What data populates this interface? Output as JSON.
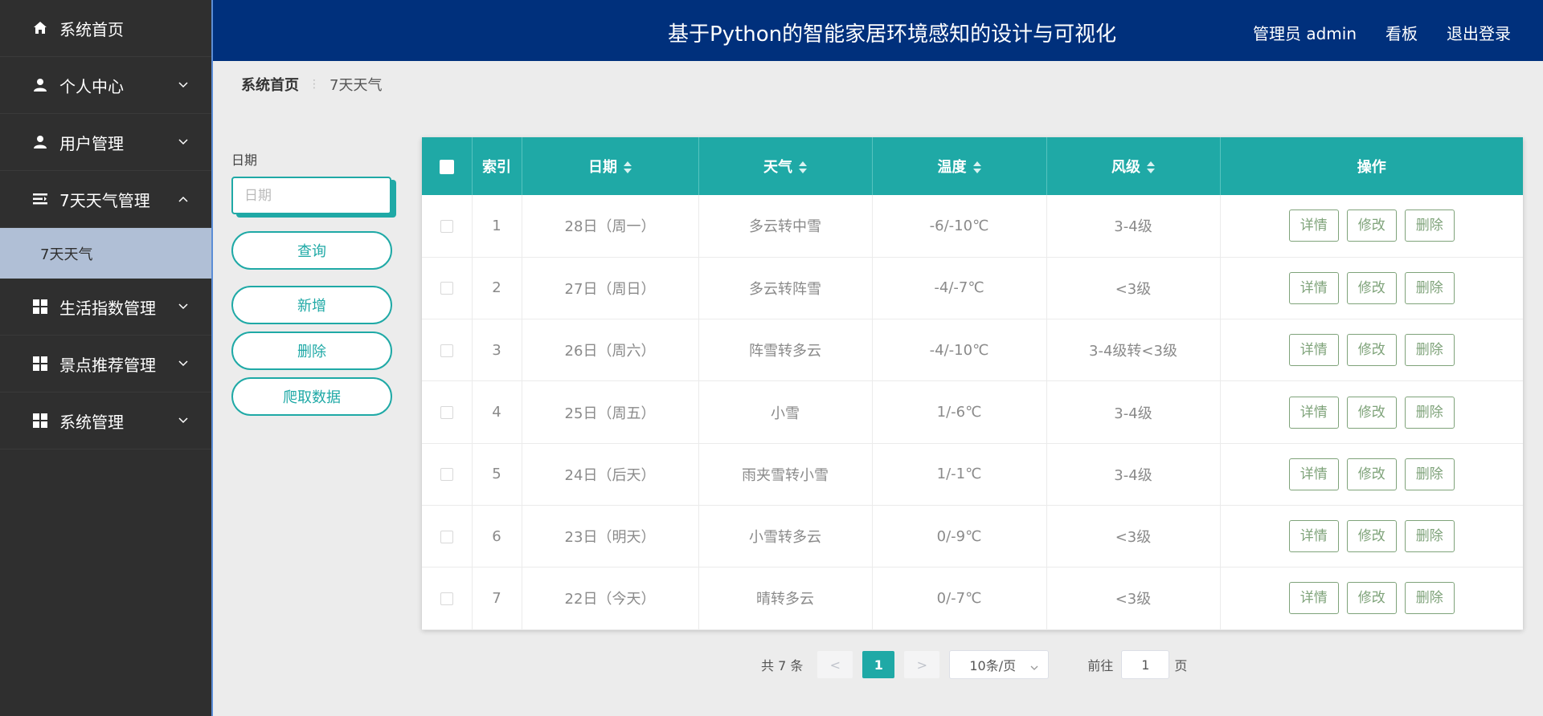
{
  "sidebar": {
    "items": [
      {
        "label": "系统首页",
        "icon": "home-icon"
      },
      {
        "label": "个人中心",
        "icon": "user-icon"
      },
      {
        "label": "用户管理",
        "icon": "user-icon"
      },
      {
        "label": "7天天气管理",
        "icon": "list-icon"
      },
      {
        "label": "生活指数管理",
        "icon": "grid-icon"
      },
      {
        "label": "景点推荐管理",
        "icon": "grid-icon"
      },
      {
        "label": "系统管理",
        "icon": "grid-icon"
      }
    ],
    "sub_item": "7天天气"
  },
  "header": {
    "title": "基于Python的智能家居环境感知的设计与可视化",
    "user": "管理员 admin",
    "board": "看板",
    "logout": "退出登录"
  },
  "breadcrumb": {
    "home": "系统首页",
    "current": "7天天气"
  },
  "search": {
    "label": "日期",
    "placeholder": "日期",
    "query": "查询",
    "add": "新增",
    "delete": "删除",
    "crawl": "爬取数据"
  },
  "table": {
    "headers": {
      "index": "索引",
      "date": "日期",
      "weather": "天气",
      "temp": "温度",
      "wind": "风级",
      "ops": "操作"
    },
    "rows": [
      {
        "index": "1",
        "date": "28日（周一）",
        "weather": "多云转中雪",
        "temp": "-6/-10℃",
        "wind": "3-4级"
      },
      {
        "index": "2",
        "date": "27日（周日）",
        "weather": "多云转阵雪",
        "temp": "-4/-7℃",
        "wind": "<3级"
      },
      {
        "index": "3",
        "date": "26日（周六）",
        "weather": "阵雪转多云",
        "temp": "-4/-10℃",
        "wind": "3-4级转<3级"
      },
      {
        "index": "4",
        "date": "25日（周五）",
        "weather": "小雪",
        "temp": "1/-6℃",
        "wind": "3-4级"
      },
      {
        "index": "5",
        "date": "24日（后天）",
        "weather": "雨夹雪转小雪",
        "temp": "1/-1℃",
        "wind": "3-4级"
      },
      {
        "index": "6",
        "date": "23日（明天）",
        "weather": "小雪转多云",
        "temp": "0/-9℃",
        "wind": "<3级"
      },
      {
        "index": "7",
        "date": "22日（今天）",
        "weather": "晴转多云",
        "temp": "0/-7℃",
        "wind": "<3级"
      }
    ],
    "actions": {
      "detail": "详情",
      "edit": "修改",
      "delete": "删除"
    }
  },
  "pagination": {
    "total": "共 7 条",
    "prev": "<",
    "page": "1",
    "next": ">",
    "page_size": "10条/页",
    "goto_prefix": "前往",
    "goto_value": "1",
    "goto_suffix": "页"
  },
  "colors": {
    "accent": "#1fa9a6",
    "header_bg": "#00307c",
    "sidebar_bg": "#2f2f2f",
    "action_btn": "#7fa37a"
  }
}
